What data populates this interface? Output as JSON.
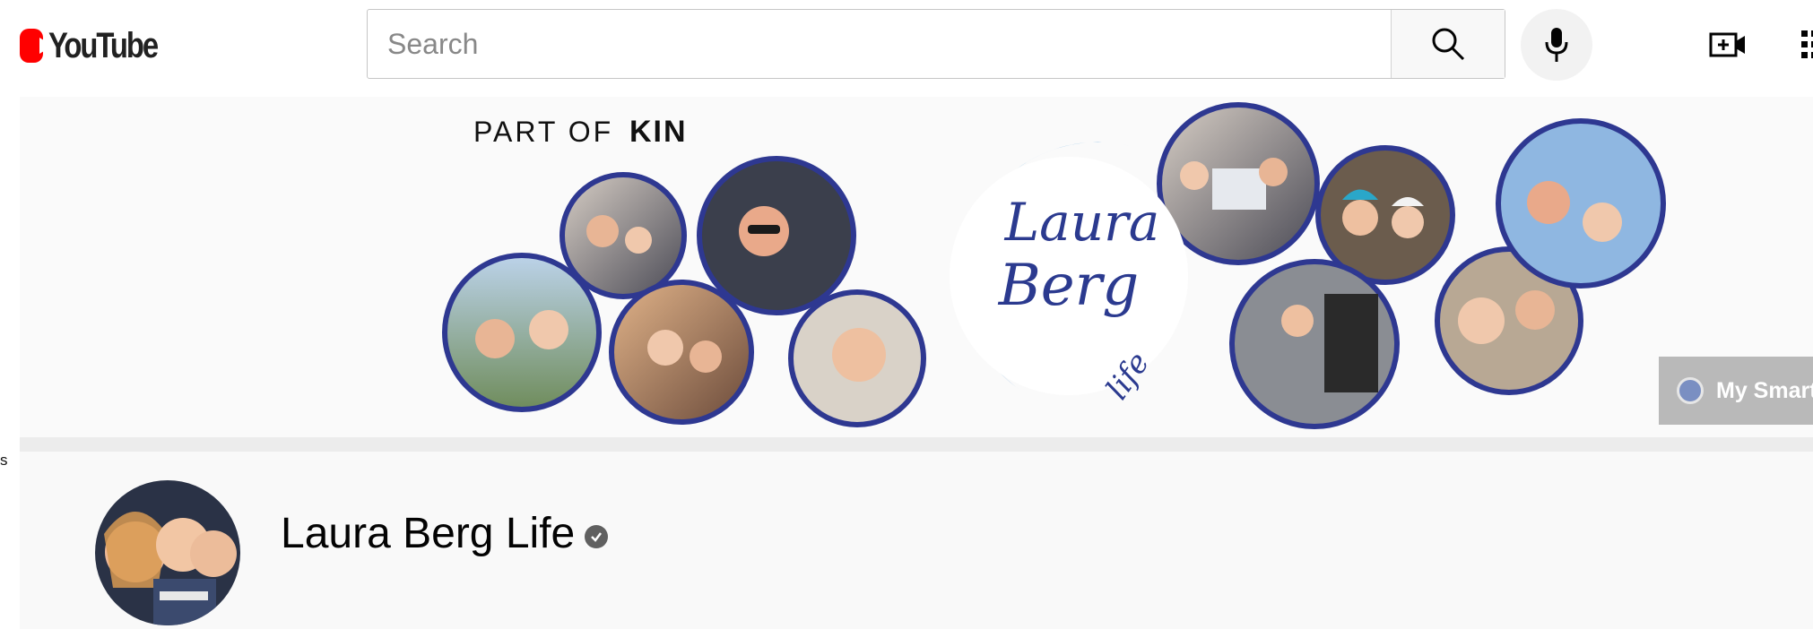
{
  "header": {
    "logo_text": "YouTube",
    "search": {
      "placeholder": "Search",
      "value": ""
    },
    "icons": [
      "search-icon",
      "mic-icon",
      "create-video-icon",
      "apps-grid-icon"
    ]
  },
  "banner": {
    "part_of": "PART OF",
    "kin": "KIN",
    "logo_line1": "Laura",
    "logo_line2": "Berg",
    "logo_line3": "life",
    "overlay_label": "My Smart"
  },
  "sidebar_fragment": "s",
  "channel": {
    "name": "Laura Berg Life",
    "verified": true
  },
  "colors": {
    "brand_red": "#ff0000",
    "circle_border": "#2e3891",
    "logo_blue": "#2b3a8f",
    "swoosh_blue": "#3a8fd6"
  }
}
